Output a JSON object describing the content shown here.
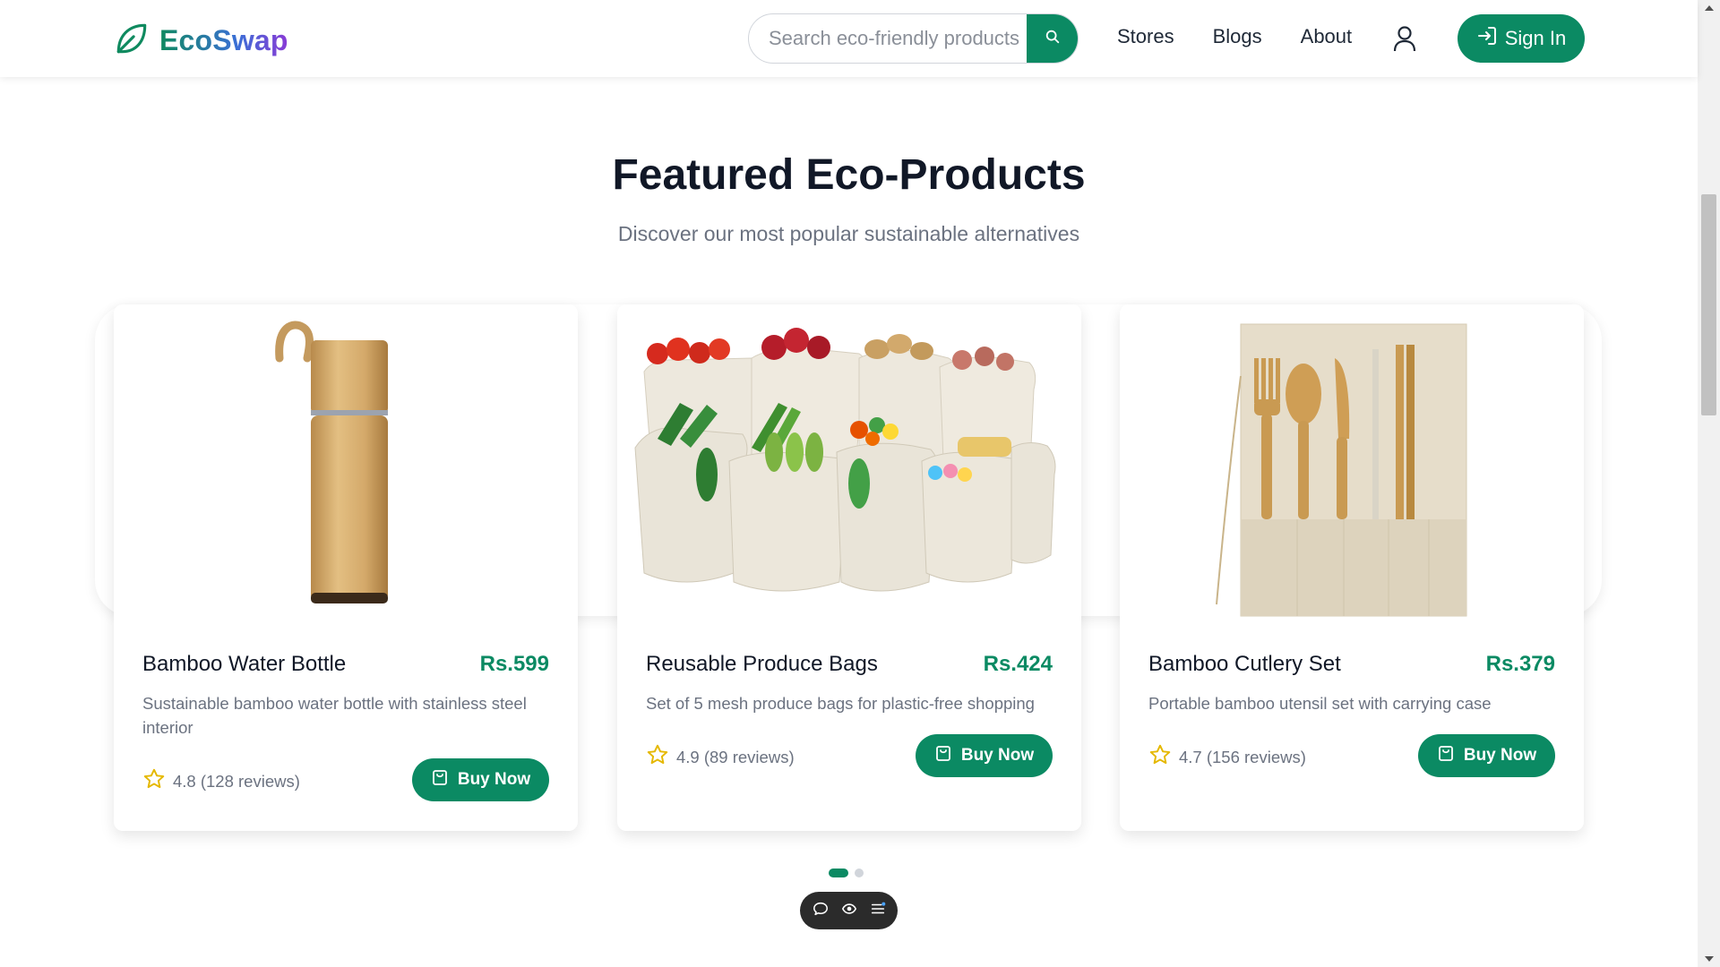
{
  "header": {
    "logo_text": "EcoSwap",
    "search": {
      "placeholder": "Search eco-friendly products",
      "value": ""
    },
    "nav": [
      "Stores",
      "Blogs",
      "About"
    ],
    "signin_label": "Sign In"
  },
  "section": {
    "title": "Featured Eco-Products",
    "subtitle": "Discover our most popular sustainable alternatives"
  },
  "products": [
    {
      "name": "Bamboo Water Bottle",
      "price": "Rs.599",
      "description": "Sustainable bamboo water bottle with stainless steel interior",
      "rating": "4.8 (128 reviews)",
      "buy_label": "Buy Now",
      "image_icon": "bamboo-bottle"
    },
    {
      "name": "Reusable Produce Bags",
      "price": "Rs.424",
      "description": "Set of 5 mesh produce bags for plastic-free shopping",
      "rating": "4.9 (89 reviews)",
      "buy_label": "Buy Now",
      "image_icon": "produce-bags"
    },
    {
      "name": "Bamboo Cutlery Set",
      "price": "Rs.379",
      "description": "Portable bamboo utensil set with carrying case",
      "rating": "4.7 (156 reviews)",
      "buy_label": "Buy Now",
      "image_icon": "cutlery-set"
    }
  ],
  "pagination": {
    "pages": 2,
    "active": 1
  },
  "colors": {
    "accent": "#0b8a63",
    "title": "#111827",
    "muted": "#6b7280",
    "star": "#e5b800"
  },
  "icons": [
    "leaf-icon",
    "search-icon",
    "user-icon",
    "signin-icon",
    "star-icon",
    "shopping-bag-icon",
    "chat-icon",
    "eye-icon",
    "menu-icon"
  ]
}
